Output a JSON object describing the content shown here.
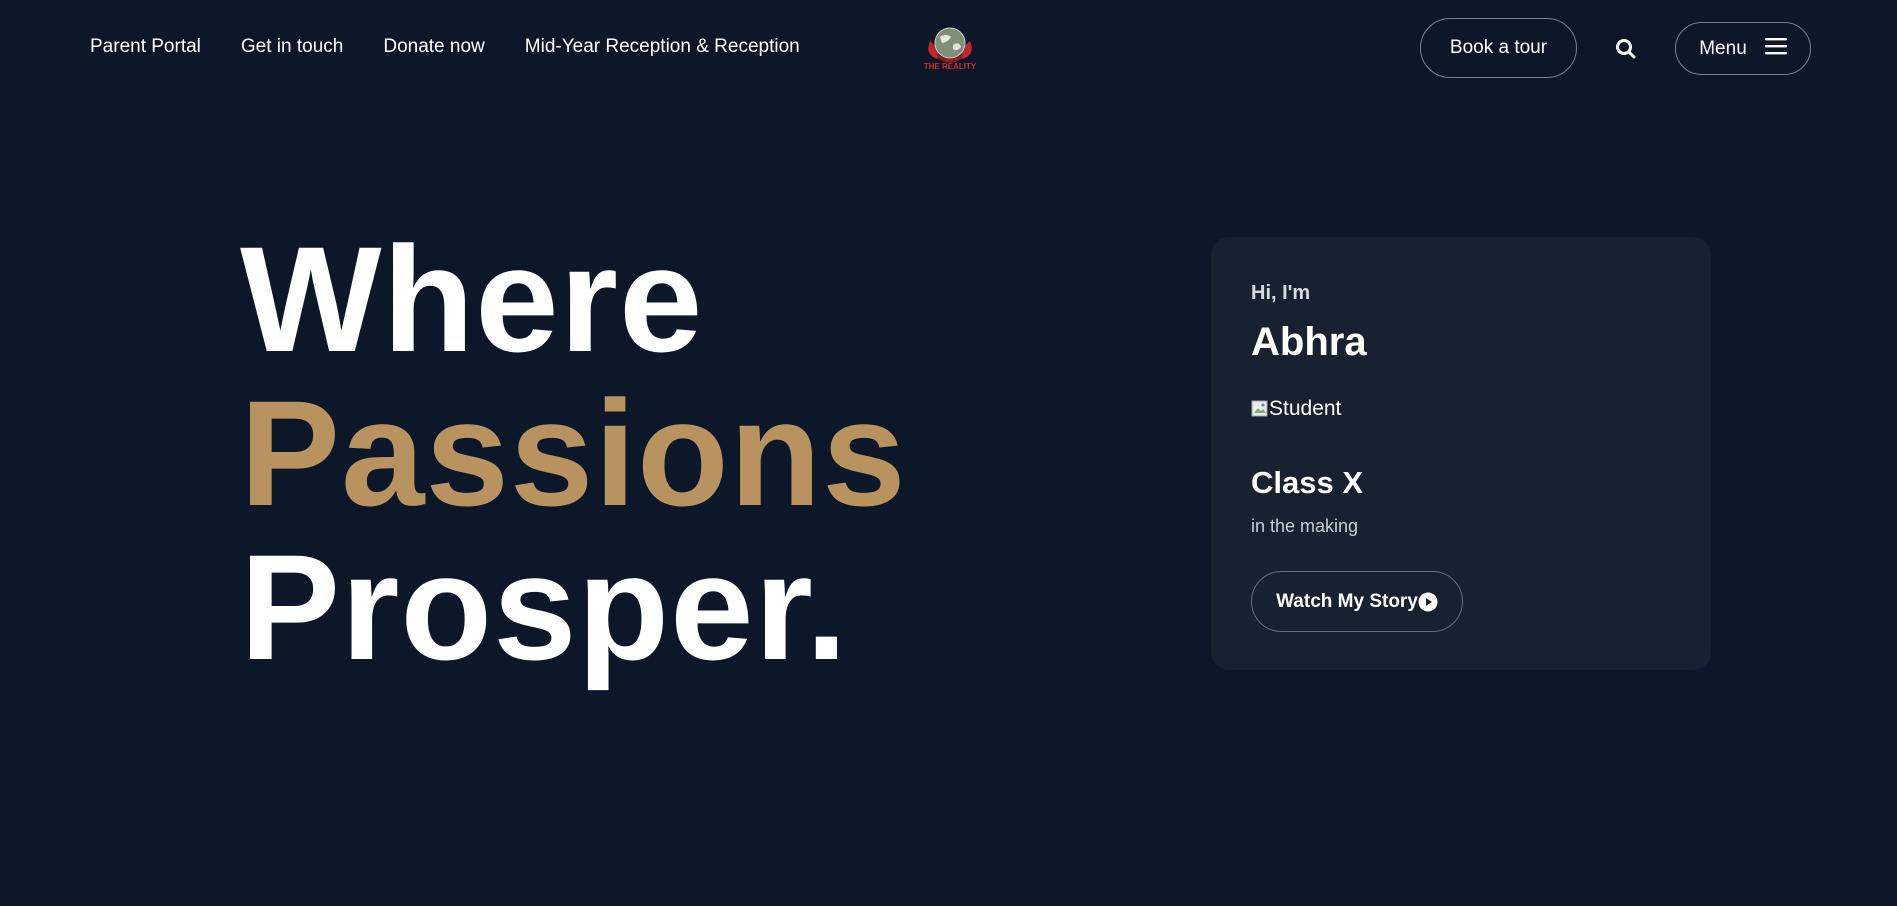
{
  "nav": {
    "links": [
      "Parent Portal",
      "Get in touch",
      "Donate now",
      "Mid-Year Reception & Reception"
    ],
    "logo_text": "THE REALITY",
    "book_tour": "Book a tour",
    "menu": "Menu"
  },
  "hero": {
    "line1": "Where",
    "line2": "Passions",
    "line3": "Prosper."
  },
  "card": {
    "greeting": "Hi, I'm",
    "name": "Abhra",
    "image_alt": "Student",
    "class_label": "Class X",
    "subtitle": "in the making",
    "watch_button": "Watch My Story"
  },
  "colors": {
    "background": "#0c1829",
    "card": "#18212f",
    "accent_gold": "#b8935f"
  },
  "icons": [
    "search-icon",
    "hamburger-icon",
    "play-icon",
    "broken-image-icon",
    "logo-globe"
  ]
}
